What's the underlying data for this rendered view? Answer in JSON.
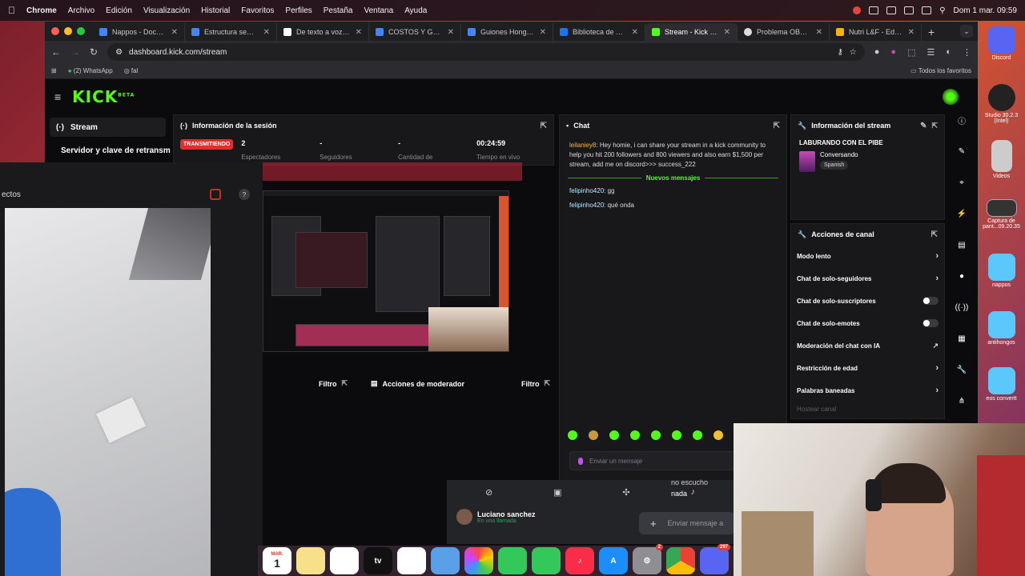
{
  "menubar": {
    "app": "Chrome",
    "items": [
      "Archivo",
      "Edición",
      "Visualización",
      "Historial",
      "Favoritos",
      "Perfiles",
      "Pestaña",
      "Ventana",
      "Ayuda"
    ],
    "clock": "Dom 1 mar. 09:59"
  },
  "browser": {
    "tabs": [
      {
        "label": "Nappos - Documen",
        "color": "#4285f4"
      },
      {
        "label": "Estructura semanal",
        "color": "#4285f4"
      },
      {
        "label": "De texto a voz | Elev",
        "color": "#ffffff"
      },
      {
        "label": "COSTOS Y GANANC",
        "color": "#4285f4"
      },
      {
        "label": "Guiones Hongos - D",
        "color": "#4285f4"
      },
      {
        "label": "Biblioteca de anunc",
        "color": "#1877f2"
      },
      {
        "label": "Stream - Kick Dashb",
        "color": "#53fc18"
      },
      {
        "label": "Problema OBS Kick",
        "color": "#dddddd"
      },
      {
        "label": "Nutri L&F - Edita te",
        "color": "#f4b400"
      }
    ],
    "active_tab": 6,
    "url": "dashboard.kick.com/stream",
    "bookmarks": [
      {
        "label": "(2) WhatsApp"
      },
      {
        "label": "fal"
      }
    ],
    "all_favorites": "Todos los favoritos"
  },
  "kick": {
    "logo": "KICK",
    "logo_sup": "BETA",
    "nav": {
      "stream": "Stream",
      "server_key": "Servidor y clave de retransm"
    },
    "session": {
      "title": "Información de la sesión",
      "status": "TRANSMITIENDO",
      "stats": [
        {
          "value": "2",
          "label": "Espectadores"
        },
        {
          "value": "-",
          "label": "Seguidores"
        },
        {
          "value": "-",
          "label": "Cantidad de"
        },
        {
          "value": "00:24:59",
          "label": "Tiempo en vivo"
        }
      ]
    },
    "chat": {
      "title": "Chat",
      "messages": [
        {
          "user": "leilaniey8",
          "text": "Hey homie, i can share your stream in a kick community to help you hit 200 followers and 800 viewers and also earn $1,500 per stream, add me on discord>>> success_222"
        }
      ],
      "new_messages_label": "Nuevos mensajes",
      "new": [
        {
          "user": "felipinho420",
          "text": "gg"
        },
        {
          "user": "felipinho420",
          "text": "qué onda"
        }
      ],
      "input_placeholder": "Enviar un mensaje"
    },
    "stream_info": {
      "title": "Información del stream",
      "stream_title": "LABURANDO CON EL PIBE",
      "category": "Conversando",
      "language": "Spanish"
    },
    "channel_actions": {
      "title": "Acciones de canal",
      "rows": [
        {
          "label": "Modo lento",
          "control": "chevron"
        },
        {
          "label": "Chat de solo-seguidores",
          "control": "chevron"
        },
        {
          "label": "Chat de solo-suscriptores",
          "control": "toggle"
        },
        {
          "label": "Chat de solo-emotes",
          "control": "toggle"
        },
        {
          "label": "Moderación del chat con IA",
          "control": "chart"
        },
        {
          "label": "Restricción de edad",
          "control": "chevron"
        },
        {
          "label": "Palabras baneadas",
          "control": "chevron"
        },
        {
          "label": "Hostear canal",
          "control": "none"
        }
      ]
    },
    "mod_actions": {
      "title": "Acciones de moderador",
      "filter": "Filtro"
    },
    "left_filter": "Filtro"
  },
  "obs": {
    "title_partial": "ectos",
    "help": "?"
  },
  "discord": {
    "user": "Luciano sanchez",
    "status": "En una llamada",
    "messages": [
      "no escucho",
      "nada"
    ],
    "input_placeholder": "Enviar mensaje a"
  },
  "dock": {
    "calendar_month": "MAR.",
    "calendar_day": "1",
    "tv_label": "tv",
    "settings_badge": "2",
    "discord_badge": "297"
  },
  "desktop": {
    "items": [
      {
        "label": "Discord"
      },
      {
        "label": "Studio 30.2.3 (Intel)"
      },
      {
        "label": "Videos"
      },
      {
        "label": "Captura de pant...09.20.35"
      },
      {
        "label": "nappos"
      },
      {
        "label": "antihongos"
      },
      {
        "label": "eos convertt"
      }
    ]
  }
}
